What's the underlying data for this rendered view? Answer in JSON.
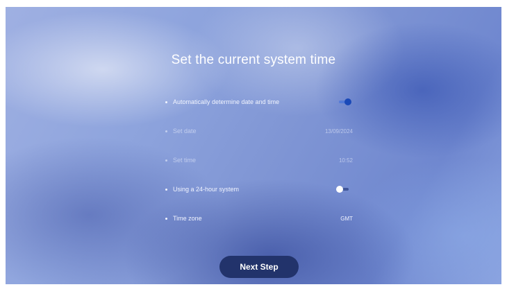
{
  "page": {
    "title": "Set the current system time"
  },
  "settings": {
    "auto_datetime": {
      "label": "Automatically determine date and time",
      "enabled": true
    },
    "set_date": {
      "label": "Set date",
      "value": "13/09/2024"
    },
    "set_time": {
      "label": "Set time",
      "value": "10:52"
    },
    "hour24": {
      "label": "Using a 24-hour system",
      "enabled": false
    },
    "time_zone": {
      "label": "Time zone",
      "value": "GMT"
    }
  },
  "footer": {
    "next_label": "Next Step"
  },
  "colors": {
    "toggle_on": "#1a49b8",
    "button_bg": "#22336b"
  }
}
